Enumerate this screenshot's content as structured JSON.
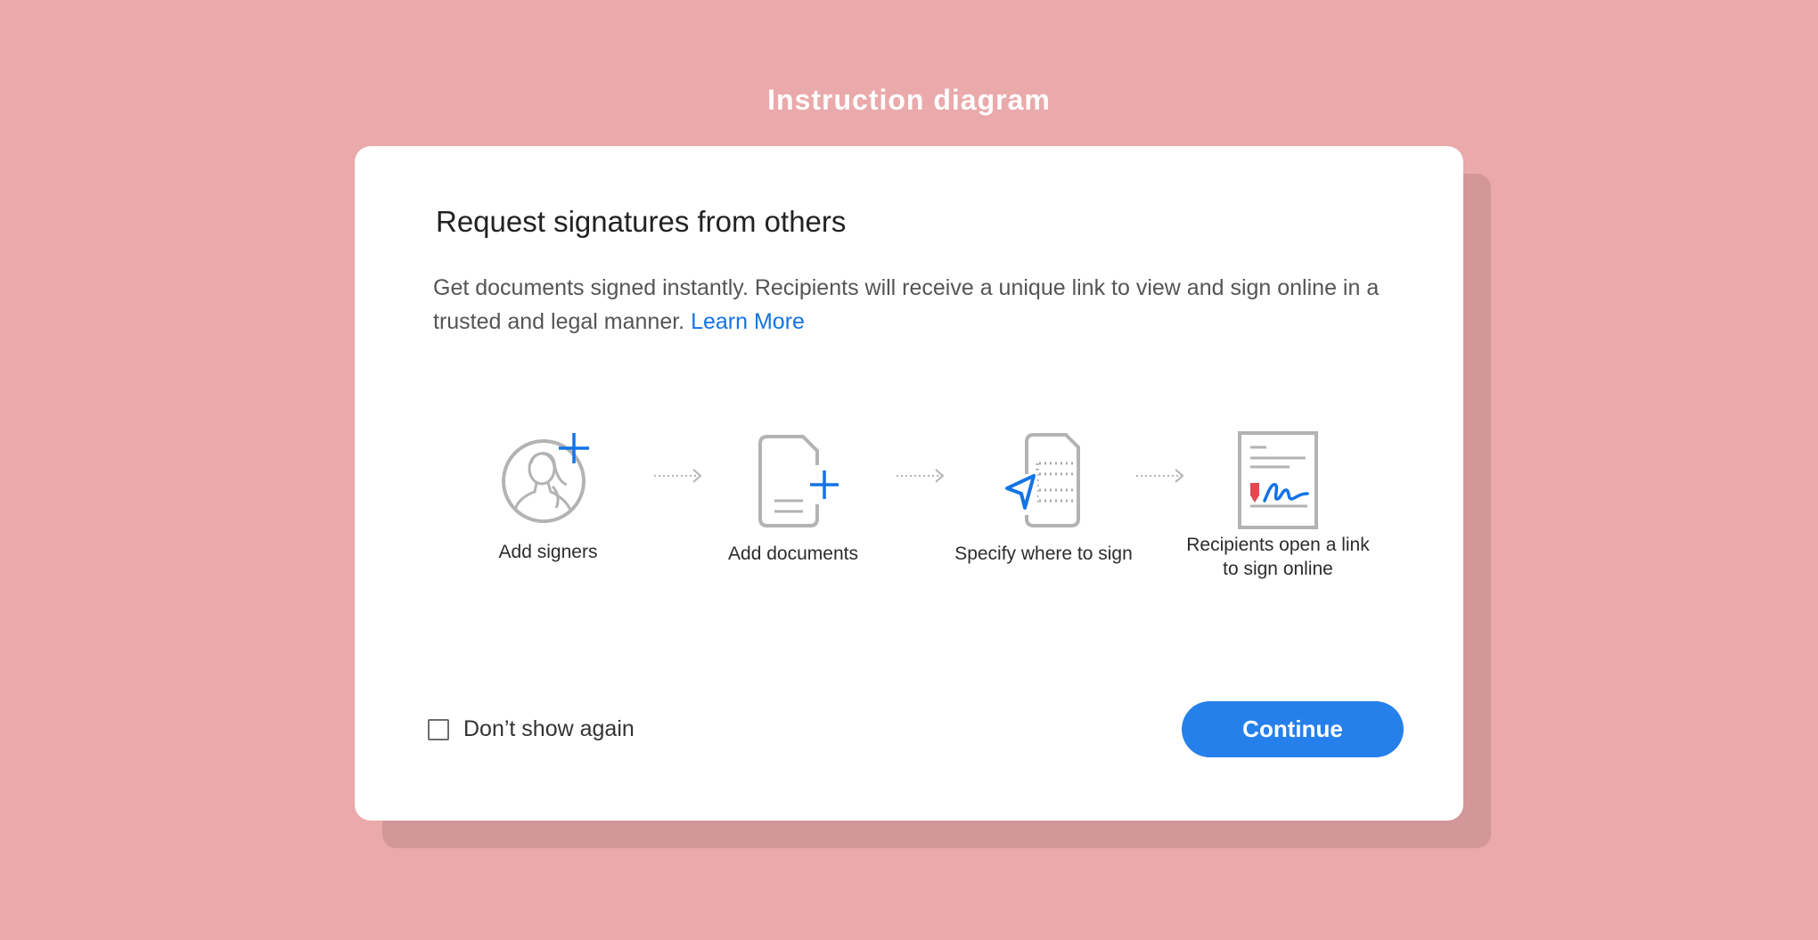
{
  "page": {
    "heading": "Instruction diagram"
  },
  "dialog": {
    "title": "Request signatures from others",
    "description": "Get documents signed instantly. Recipients will receive a unique link to view and sign online in a trusted and legal manner.",
    "learn_more": "Learn More",
    "steps": [
      {
        "label": "Add signers",
        "icon": "add-signer-icon"
      },
      {
        "label": "Add documents",
        "icon": "add-document-icon"
      },
      {
        "label": "Specify where to sign",
        "icon": "specify-sign-location-icon"
      },
      {
        "label": "Recipients open a link to sign online",
        "icon": "signed-document-icon"
      }
    ],
    "dont_show_label": "Don’t show again",
    "dont_show_checked": false,
    "continue_label": "Continue"
  },
  "colors": {
    "background": "#eaa9aa",
    "accent": "#2680eb",
    "link": "#1473e6",
    "icon_gray": "#b3b3b3",
    "signature_marker": "#e34850"
  }
}
